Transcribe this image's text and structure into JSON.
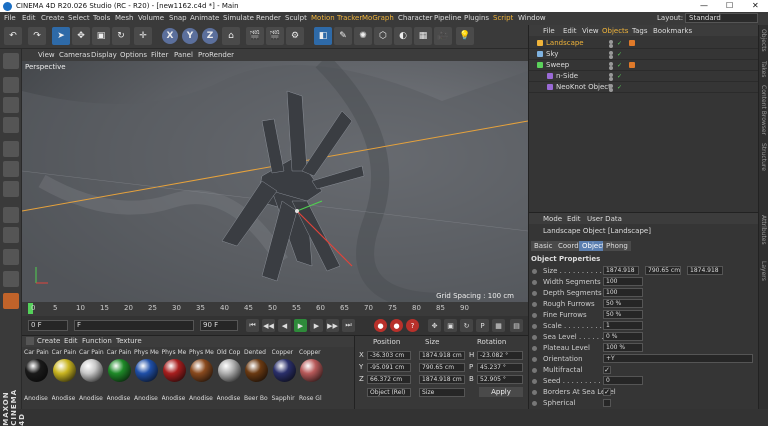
{
  "window": {
    "title": "CINEMA 4D R20.026 Studio (RC - R20) - [new1162.c4d *] - Main",
    "minimize": "—",
    "maximize": "☐",
    "close": "✕"
  },
  "menu": [
    "File",
    "Edit",
    "Create",
    "Select",
    "Tools",
    "Mesh",
    "Volume",
    "Snap",
    "Animate",
    "Simulate",
    "Render",
    "Sculpt",
    "Motion Tracker",
    "MoGraph",
    "Character",
    "Pipeline",
    "Plugins",
    "Script",
    "Window"
  ],
  "layout": {
    "label": "Layout:",
    "value": "Standard"
  },
  "viewport": {
    "menu": [
      "View",
      "Cameras",
      "Display",
      "Options",
      "Filter",
      "Panel",
      "ProRender"
    ],
    "label": "Perspective",
    "grid_spacing": "Grid Spacing : 100 cm"
  },
  "timeline": {
    "ticks": [
      "0",
      "5",
      "10",
      "15",
      "20",
      "25",
      "30",
      "35",
      "40",
      "45",
      "50",
      "55",
      "60",
      "65",
      "70",
      "75",
      "80",
      "85",
      "90"
    ]
  },
  "transport": {
    "start": "0 F",
    "current": "0 F",
    "end": "90 F",
    "max": "90 F",
    "fps_field": "F"
  },
  "materials": {
    "menu": [
      "Create",
      "Edit",
      "Function",
      "Texture"
    ],
    "items": [
      {
        "name": "Car Pain",
        "label": "Anodise",
        "color": "#1a1a1a"
      },
      {
        "name": "Car Pain",
        "label": "Anodise",
        "color": "#c9b520"
      },
      {
        "name": "Car Pain",
        "label": "Anodise",
        "color": "#c8c8c8"
      },
      {
        "name": "Car Pain",
        "label": "Anodise",
        "color": "#1e8a28"
      },
      {
        "name": "Phys Me",
        "label": "Anodise",
        "color": "#1f4fa8"
      },
      {
        "name": "Phys Me",
        "label": "Anodise",
        "color": "#a81e1e"
      },
      {
        "name": "Phys Me",
        "label": "Anodise",
        "color": "#8a4a1e"
      },
      {
        "name": "Old Cop",
        "label": "Anodise",
        "color": "#b0b0b0"
      },
      {
        "name": "Dented",
        "label": "Beer Bo",
        "color": "#6b3a12"
      },
      {
        "name": "Copper",
        "label": "Sapphir",
        "color": "#2a2f6b"
      },
      {
        "name": "Copper",
        "label": "Rose Gl",
        "color": "#b85a5a"
      }
    ]
  },
  "coords": {
    "headers": {
      "position": "Position",
      "size": "Size",
      "rotation": "Rotation"
    },
    "rows": [
      {
        "axis": "X",
        "pos": "-36.303 cm",
        "size": "1874.918 cm",
        "rlabel": "H",
        "rot": "-23.082 °"
      },
      {
        "axis": "Y",
        "pos": "-95.091 cm",
        "size": "790.65 cm",
        "rlabel": "P",
        "rot": "45.237 °"
      },
      {
        "axis": "Z",
        "pos": "66.372 cm",
        "size": "1874.918 cm",
        "rlabel": "B",
        "rot": "52.905 °"
      }
    ],
    "mode": "Object (Rel)",
    "size_mode": "Size",
    "apply": "Apply"
  },
  "objects": {
    "tabs": [
      "File",
      "Edit",
      "View",
      "Objects",
      "Tags",
      "Bookmarks"
    ],
    "active_tab": "Objects",
    "items": [
      {
        "name": "Landscape",
        "color": "#f0b43a",
        "indent": 0
      },
      {
        "name": "Sky",
        "color": "#7fb2e0",
        "indent": 0
      },
      {
        "name": "Sweep",
        "color": "#5bd15b",
        "indent": 0
      },
      {
        "name": "n-Side",
        "color": "#9a6ad6",
        "indent": 1
      },
      {
        "name": "NeoKnot Object",
        "color": "#9a6ad6",
        "indent": 1
      }
    ]
  },
  "attributes": {
    "menu": [
      "Mode",
      "Edit",
      "User Data"
    ],
    "title": "Landscape Object [Landscape]",
    "tabs": [
      "Basic",
      "Coord",
      "Object",
      "Phong"
    ],
    "active_tab": "Object",
    "section": "Object Properties",
    "rows": [
      {
        "label": "Size . . . . . . . . . . . .",
        "values": [
          "1874.918",
          "790.65 cm",
          "1874.918"
        ]
      },
      {
        "label": "Width Segments",
        "values": [
          "100"
        ]
      },
      {
        "label": "Depth Segments",
        "values": [
          "100"
        ]
      },
      {
        "label": "Rough Furrows",
        "values": [
          "50 %"
        ]
      },
      {
        "label": "Fine Furrows",
        "values": [
          "50 %"
        ]
      },
      {
        "label": "Scale . . . . . . . . .",
        "values": [
          "1"
        ]
      },
      {
        "label": "Sea Level . . . . . .",
        "values": [
          "0 %"
        ]
      },
      {
        "label": "Plateau Level",
        "values": [
          "100 %"
        ]
      },
      {
        "label": "Orientation",
        "values": [
          "+Y"
        ]
      },
      {
        "label": "Multifractal",
        "check": "✓"
      },
      {
        "label": "Seed . . . . . . . . .",
        "values": [
          "0"
        ]
      },
      {
        "label": "Borders At Sea Level",
        "check": "✓"
      },
      {
        "label": "Spherical",
        "check": ""
      }
    ]
  },
  "side_tabs": [
    "Objects",
    "Takes",
    "Content Browser",
    "Structure",
    "Attributes",
    "Layers"
  ],
  "brand": "MAXON CINEMA 4D"
}
